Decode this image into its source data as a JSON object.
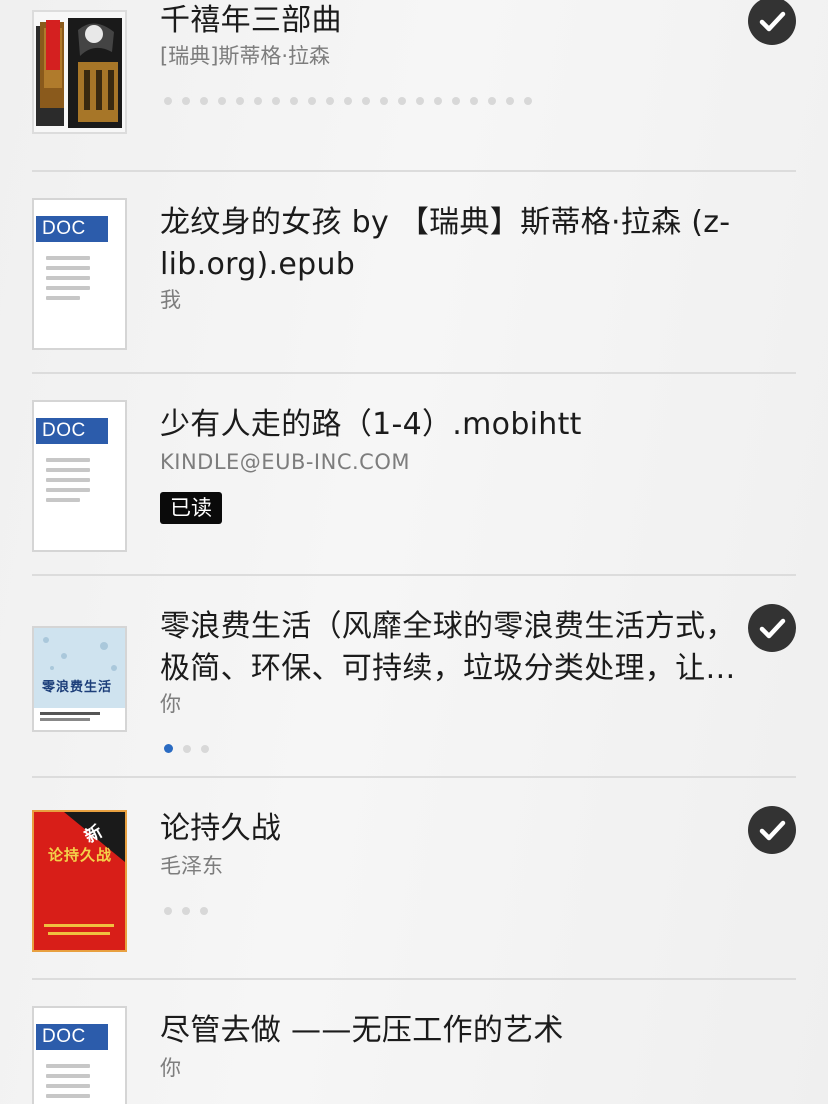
{
  "books": [
    {
      "title": "千禧年三部曲",
      "author": "[瑞典]斯蒂格·拉森",
      "cover": "photo-cover-millennium",
      "checked": true,
      "progress_dots": 21
    },
    {
      "title_line1": "龙纹身的女孩 by 【瑞典】斯蒂格·拉森 (z-",
      "title_line2": "lib.org).epub",
      "author": "我",
      "cover_badge": "DOC",
      "checked": false
    },
    {
      "title": "少有人走的路（1-4）.mobihtt",
      "author": "KINDLE@EUB-INC.COM",
      "cover_badge": "DOC",
      "badge": "已读",
      "checked": false
    },
    {
      "title_line1": "零浪费生活（风靡全球的零浪费生活方式，",
      "title_line2": "极简、环保、可持续，垃圾分类处理，让…",
      "author": "你",
      "cover_title": "零浪费生活",
      "checked": true,
      "progress_dots": 3,
      "active_dot": 0
    },
    {
      "title": "论持久战",
      "author": "毛泽东",
      "cover_title": "论持久战",
      "cover_new": "新",
      "checked": true,
      "progress_dots": 3
    },
    {
      "title": "尽管去做 ——无压工作的艺术",
      "author": "你",
      "cover_badge": "DOC",
      "checked": false
    }
  ],
  "colors": {
    "doc_badge": "#2c5cab",
    "check_bg": "#333333",
    "active_dot": "#2a6bc2",
    "red_cover": "#d81e18"
  }
}
